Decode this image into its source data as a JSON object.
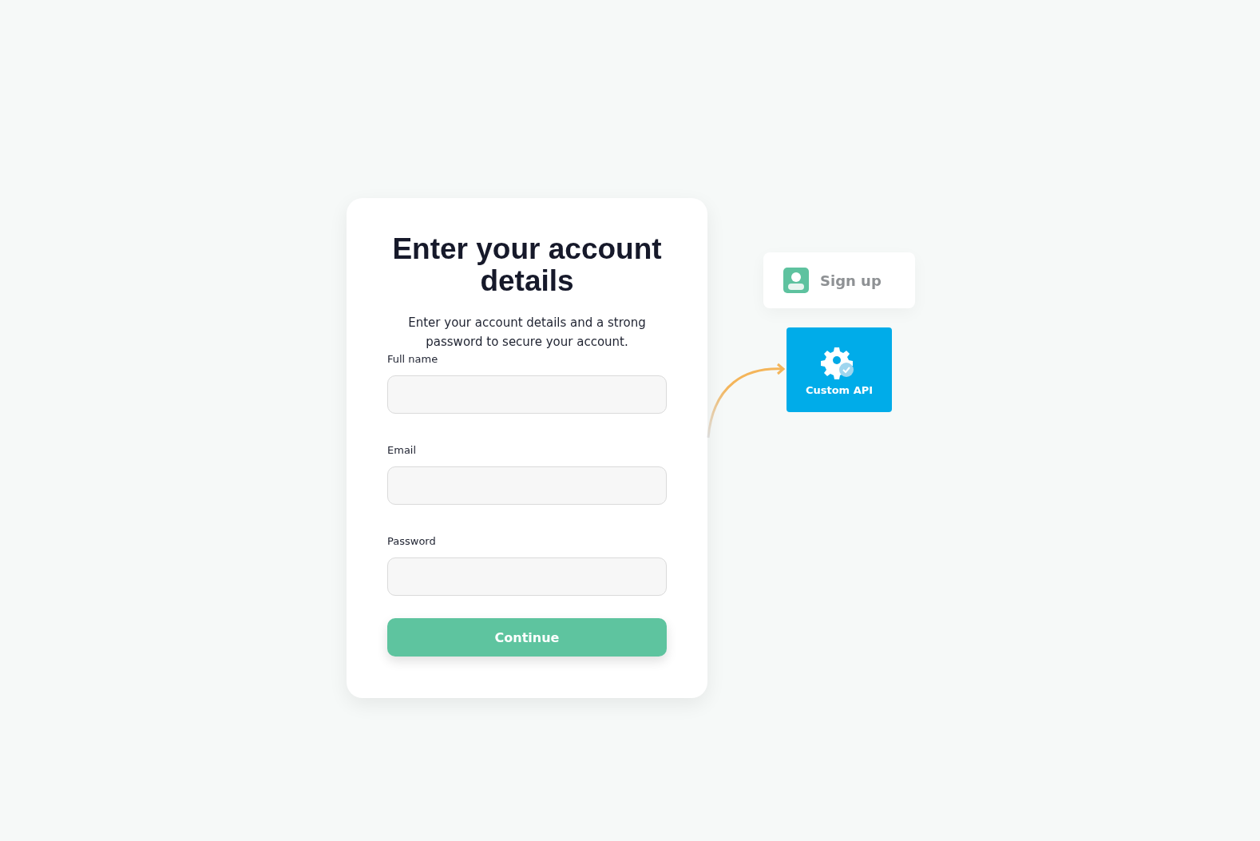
{
  "form": {
    "title": "Enter your account details",
    "subtitle": "Enter your account details and a strong password to secure your account.",
    "fields": [
      {
        "label": "Full name"
      },
      {
        "label": "Email"
      },
      {
        "label": "Password"
      }
    ],
    "button": "Continue"
  },
  "steps": [
    {
      "kind": "card",
      "label": "Sign up"
    },
    {
      "kind": "tile",
      "label": "Custom API"
    }
  ]
}
